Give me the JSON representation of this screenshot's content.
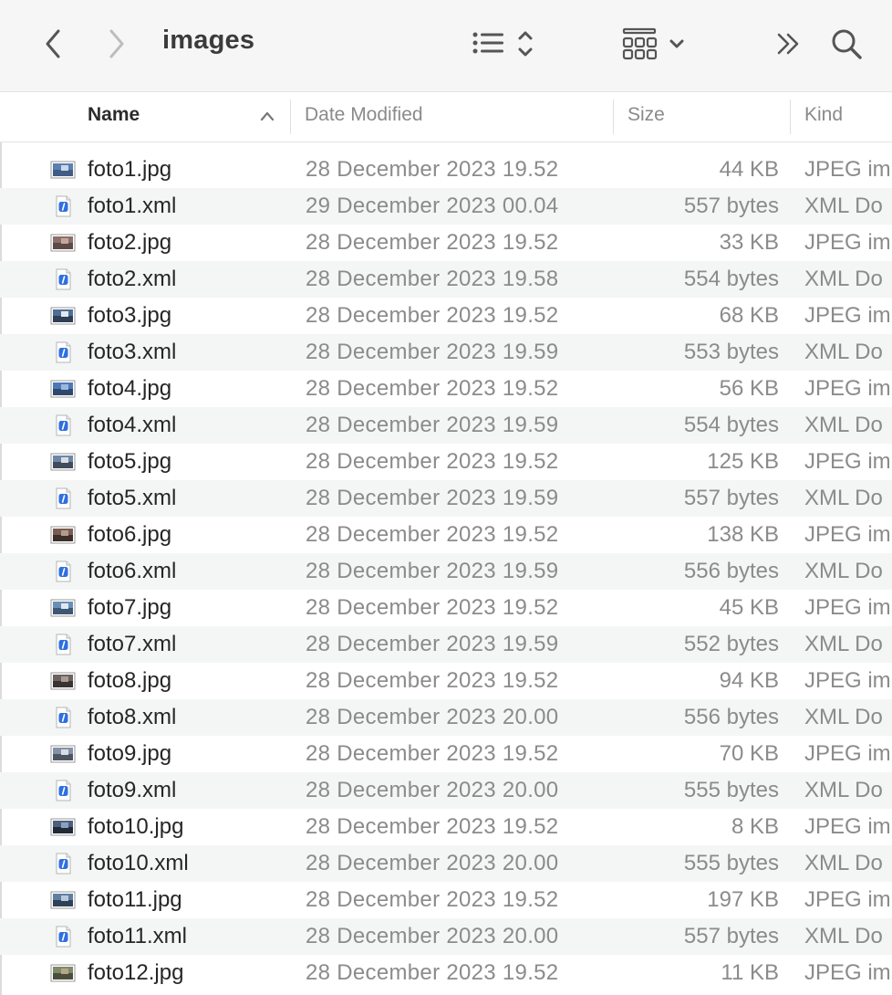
{
  "window": {
    "title": "images"
  },
  "toolbar": {
    "back_icon": "chevron-left-icon",
    "forward_icon": "chevron-right-icon",
    "view_list_icon": "list-view-icon",
    "group_icon": "grid-group-icon",
    "more_icon": "double-chevron-right-icon",
    "search_icon": "magnifier-icon"
  },
  "columns": {
    "name": "Name",
    "date": "Date Modified",
    "size": "Size",
    "kind": "Kind"
  },
  "files": [
    {
      "name": "foto1.jpg",
      "date": "28 December 2023 19.52",
      "size": "44 KB",
      "kind": "JPEG im",
      "type": "jpg"
    },
    {
      "name": "foto1.xml",
      "date": "29 December 2023 00.04",
      "size": "557 bytes",
      "kind": "XML Do",
      "type": "xml"
    },
    {
      "name": "foto2.jpg",
      "date": "28 December 2023 19.52",
      "size": "33 KB",
      "kind": "JPEG im",
      "type": "jpg"
    },
    {
      "name": "foto2.xml",
      "date": "28 December 2023 19.58",
      "size": "554 bytes",
      "kind": "XML Do",
      "type": "xml"
    },
    {
      "name": "foto3.jpg",
      "date": "28 December 2023 19.52",
      "size": "68 KB",
      "kind": "JPEG im",
      "type": "jpg"
    },
    {
      "name": "foto3.xml",
      "date": "28 December 2023 19.59",
      "size": "553 bytes",
      "kind": "XML Do",
      "type": "xml"
    },
    {
      "name": "foto4.jpg",
      "date": "28 December 2023 19.52",
      "size": "56 KB",
      "kind": "JPEG im",
      "type": "jpg"
    },
    {
      "name": "foto4.xml",
      "date": "28 December 2023 19.59",
      "size": "554 bytes",
      "kind": "XML Do",
      "type": "xml"
    },
    {
      "name": "foto5.jpg",
      "date": "28 December 2023 19.52",
      "size": "125 KB",
      "kind": "JPEG im",
      "type": "jpg"
    },
    {
      "name": "foto5.xml",
      "date": "28 December 2023 19.59",
      "size": "557 bytes",
      "kind": "XML Do",
      "type": "xml"
    },
    {
      "name": "foto6.jpg",
      "date": "28 December 2023 19.52",
      "size": "138 KB",
      "kind": "JPEG im",
      "type": "jpg"
    },
    {
      "name": "foto6.xml",
      "date": "28 December 2023 19.59",
      "size": "556 bytes",
      "kind": "XML Do",
      "type": "xml"
    },
    {
      "name": "foto7.jpg",
      "date": "28 December 2023 19.52",
      "size": "45 KB",
      "kind": "JPEG im",
      "type": "jpg"
    },
    {
      "name": "foto7.xml",
      "date": "28 December 2023 19.59",
      "size": "552 bytes",
      "kind": "XML Do",
      "type": "xml"
    },
    {
      "name": "foto8.jpg",
      "date": "28 December 2023 19.52",
      "size": "94 KB",
      "kind": "JPEG im",
      "type": "jpg"
    },
    {
      "name": "foto8.xml",
      "date": "28 December 2023 20.00",
      "size": "556 bytes",
      "kind": "XML Do",
      "type": "xml"
    },
    {
      "name": "foto9.jpg",
      "date": "28 December 2023 19.52",
      "size": "70 KB",
      "kind": "JPEG im",
      "type": "jpg"
    },
    {
      "name": "foto9.xml",
      "date": "28 December 2023 20.00",
      "size": "555 bytes",
      "kind": "XML Do",
      "type": "xml"
    },
    {
      "name": "foto10.jpg",
      "date": "28 December 2023 19.52",
      "size": "8 KB",
      "kind": "JPEG im",
      "type": "jpg"
    },
    {
      "name": "foto10.xml",
      "date": "28 December 2023 20.00",
      "size": "555 bytes",
      "kind": "XML Do",
      "type": "xml"
    },
    {
      "name": "foto11.jpg",
      "date": "28 December 2023 19.52",
      "size": "197 KB",
      "kind": "JPEG im",
      "type": "jpg"
    },
    {
      "name": "foto11.xml",
      "date": "28 December 2023 20.00",
      "size": "557 bytes",
      "kind": "XML Do",
      "type": "xml"
    },
    {
      "name": "foto12.jpg",
      "date": "28 December 2023 19.52",
      "size": "11 KB",
      "kind": "JPEG im",
      "type": "jpg"
    }
  ],
  "colors": {
    "accent": "#2f6fe0",
    "row_alt": "#f4f5f5",
    "secondary_text": "#8b8b8b"
  }
}
